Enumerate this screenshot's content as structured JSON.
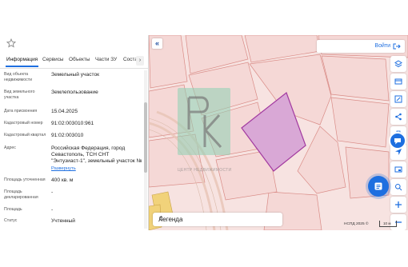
{
  "panel": {
    "tabs": [
      "Информация",
      "Сервисы",
      "Объекты",
      "Части ЗУ",
      "Состав"
    ],
    "rows": [
      {
        "label": "Вид объекта недвижимости",
        "value": "Земельный участок"
      },
      {
        "label": "Вид земельного участка",
        "value": "Землепользование"
      },
      {
        "label": "Дата присвоения",
        "value": "15.04.2025"
      },
      {
        "label": "Кадастровый номер",
        "value": "91:02:003010:961"
      },
      {
        "label": "Кадастровый квартал",
        "value": "91:02:003010"
      },
      {
        "label": "Адрес",
        "value": "Российская Федерация, город Севастополь, ТСН СНТ \"Энтузиаст-1\", земельный участок №",
        "link": "Развернуть"
      },
      {
        "label": "Площадь уточненная",
        "value": "400 кв. м"
      },
      {
        "label": "Площадь декларированная",
        "value": "-"
      },
      {
        "label": "Площадь",
        "value": "-"
      },
      {
        "label": "Статус",
        "value": "Учтенный"
      }
    ]
  },
  "map": {
    "login_label": "Войти",
    "legend_label": "Легенда",
    "attribution": "НСПД 2025 ©",
    "scale_label": "10 м",
    "watermark_text": "ЦЕНТР НЕДВИЖИМОСТИ",
    "tools": [
      "layers-icon",
      "card-icon",
      "edit-map-icon",
      "share-icon",
      "print-icon",
      "navigate-icon",
      "screen-icon",
      "search-map-icon",
      "plus-icon",
      "minus-icon"
    ]
  },
  "colors": {
    "accent": "#1e6fe0",
    "parcel_fill": "#d9a8d6",
    "parcel_stroke": "#a23aa0",
    "map_bg": "#f7e3e1"
  }
}
